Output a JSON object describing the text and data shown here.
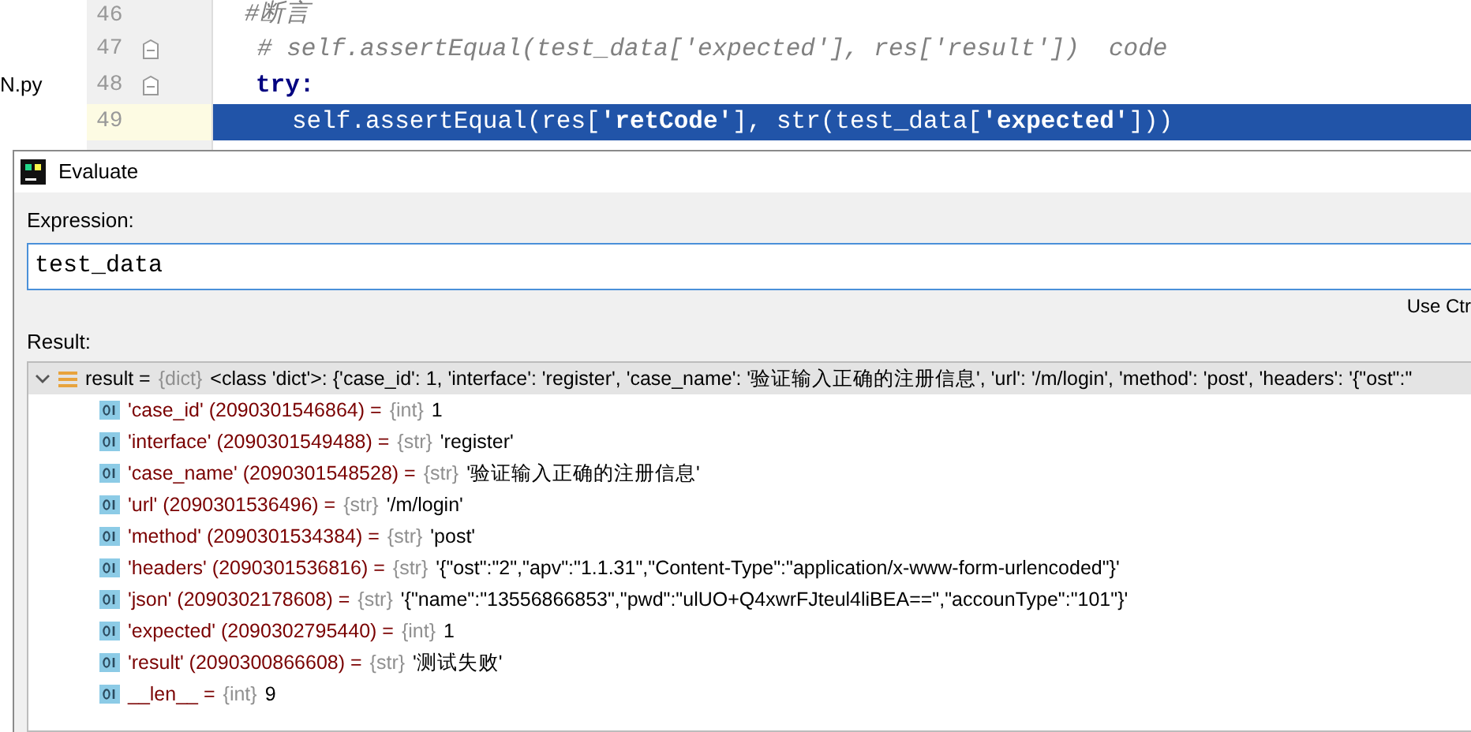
{
  "background": {
    "file_tab_fragment": "N.py"
  },
  "editor": {
    "lines": [
      {
        "number": "46",
        "kind": "comment",
        "text": "#断言",
        "current": false,
        "fold_marker": false
      },
      {
        "number": "47",
        "kind": "comment",
        "text": "# self.assertEqual(test_data['expected'], res['result'])  code",
        "current": false,
        "fold_marker": true
      },
      {
        "number": "48",
        "kind": "keyword",
        "text": "try:",
        "current": false,
        "fold_marker": true
      },
      {
        "number": "49",
        "kind": "code",
        "text": "self.assertEqual(res[**'retCode'**], str(test_data[**'expected'**]))",
        "current": true,
        "fold_marker": false
      }
    ]
  },
  "dialog": {
    "title": "Evaluate",
    "expression_label": "Expression:",
    "expression_value": "test_data",
    "hint": "Use Ctr",
    "result_label": "Result:",
    "result": {
      "label": "result =",
      "type": "{dict}",
      "value": "<class 'dict'>: {'case_id': 1, 'interface': 'register', 'case_name': '验证输入正确的注册信息', 'url': '/m/login', 'method': 'post', 'headers': '{\"ost\":\"",
      "expanded": true,
      "selected": true,
      "children": [
        {
          "label": "'case_id' (2090301546864) =",
          "type": "{int}",
          "value": "1"
        },
        {
          "label": "'interface' (2090301549488) =",
          "type": "{str}",
          "value": "'register'"
        },
        {
          "label": "'case_name' (2090301548528) =",
          "type": "{str}",
          "value": "'验证输入正确的注册信息'"
        },
        {
          "label": "'url' (2090301536496) =",
          "type": "{str}",
          "value": "'/m/login'"
        },
        {
          "label": "'method' (2090301534384) =",
          "type": "{str}",
          "value": "'post'"
        },
        {
          "label": "'headers' (2090301536816) =",
          "type": "{str}",
          "value": "'{\"ost\":\"2\",\"apv\":\"1.1.31\",\"Content-Type\":\"application/x-www-form-urlencoded\"}'"
        },
        {
          "label": "'json' (2090302178608) =",
          "type": "{str}",
          "value": "'{\"name\":\"13556866853\",\"pwd\":\"ulUO+Q4xwrFJteul4liBEA==\",\"accounType\":\"101\"}'"
        },
        {
          "label": "'expected' (2090302795440) =",
          "type": "{int}",
          "value": "1"
        },
        {
          "label": "'result' (2090300866608) =",
          "type": "{str}",
          "value": "'测试失败'"
        },
        {
          "label": "__len__ =",
          "type": "{int}",
          "value": "9"
        }
      ]
    }
  }
}
